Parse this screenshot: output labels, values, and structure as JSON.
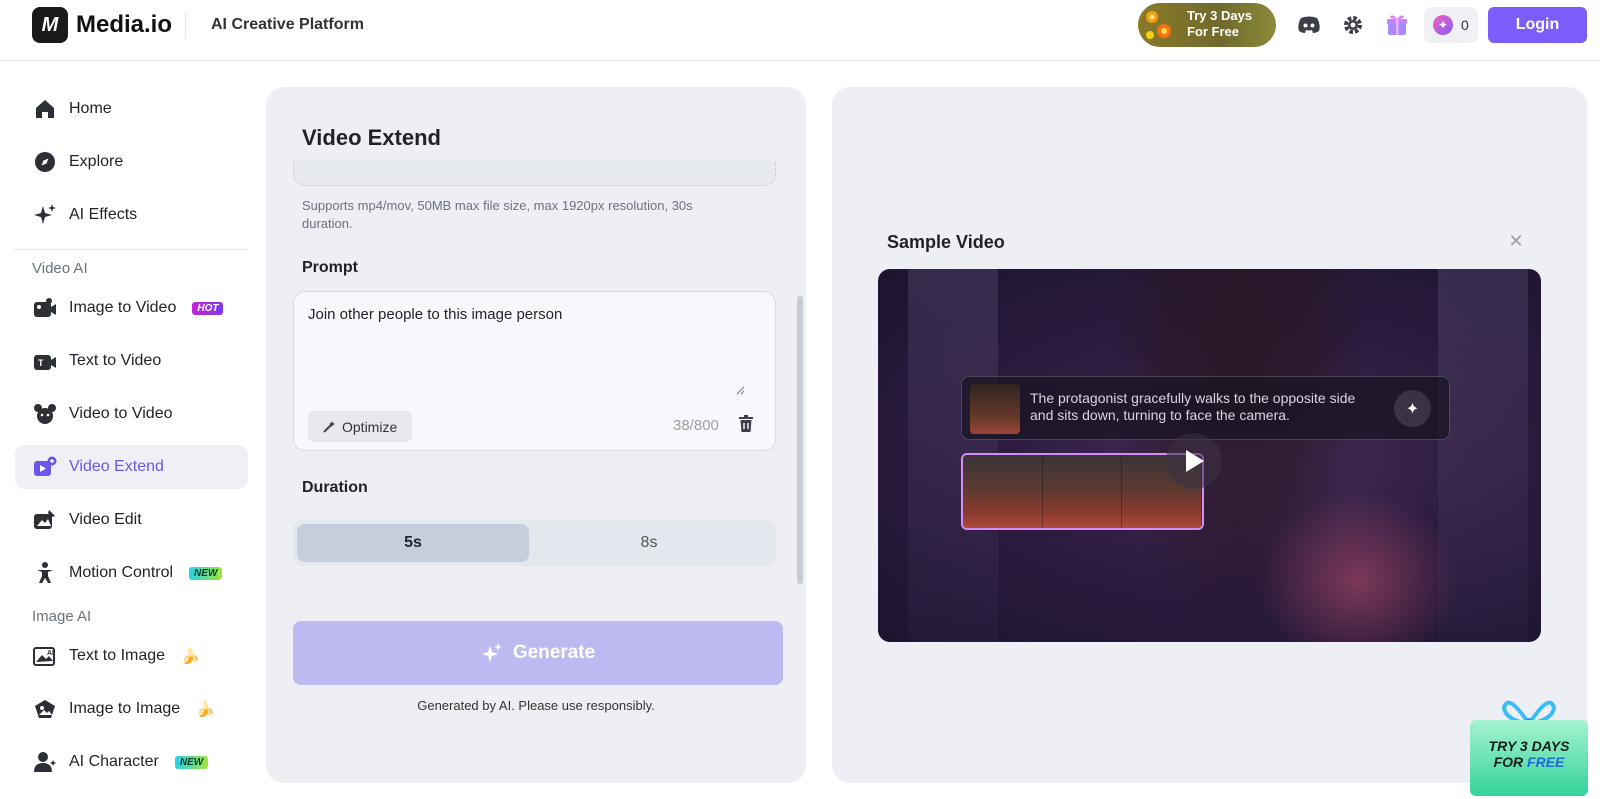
{
  "header": {
    "logo_mark": "M",
    "logo_text": "Media.io",
    "platform_label": "AI Creative Platform",
    "trial_badge": {
      "line1": "Try 3 Days",
      "line2": "For Free"
    },
    "credits": "0",
    "login_label": "Login"
  },
  "sidebar": {
    "items_top": [
      {
        "label": "Home",
        "icon": "home-icon"
      },
      {
        "label": "Explore",
        "icon": "compass-icon"
      },
      {
        "label": "AI Effects",
        "icon": "sparkles-icon"
      }
    ],
    "video_section": "Video AI",
    "video_items": [
      {
        "label": "Image to Video",
        "tag": "HOT",
        "icon": "image-to-video-icon"
      },
      {
        "label": "Text to Video",
        "icon": "text-to-video-icon"
      },
      {
        "label": "Video to Video",
        "icon": "video-to-video-icon"
      },
      {
        "label": "Video Extend",
        "icon": "video-extend-icon",
        "active": true
      },
      {
        "label": "Video Edit",
        "icon": "video-edit-icon"
      },
      {
        "label": "Motion Control",
        "tag": "NEW",
        "icon": "motion-control-icon"
      }
    ],
    "image_section": "Image AI",
    "image_items": [
      {
        "label": "Text to Image",
        "emoji": "🍌",
        "icon": "text-to-image-icon"
      },
      {
        "label": "Image to Image",
        "emoji": "🍌",
        "icon": "image-to-image-icon"
      },
      {
        "label": "AI Character",
        "tag": "NEW",
        "icon": "ai-character-icon"
      }
    ]
  },
  "tool": {
    "title": "Video Extend",
    "support_text": "Supports mp4/mov, 50MB max file size, max 1920px resolution, 30s duration.",
    "prompt_label": "Prompt",
    "prompt_value": "Join other people to this image person",
    "optimize_label": "Optimize",
    "char_count": "38/800",
    "duration_label": "Duration",
    "duration_options": [
      "5s",
      "8s"
    ],
    "duration_selected": "5s",
    "generate_label": "Generate",
    "disclaimer": "Generated by AI. Please use responsibly."
  },
  "sample": {
    "title": "Sample Video",
    "caption": "The protagonist gracefully walks to the opposite side and sits down, turning to face the camera."
  },
  "promo": {
    "line1": "TRY 3 DAYS",
    "line2a": "FOR ",
    "line2b": "FREE"
  },
  "colors": {
    "accent": "#7c5cfb",
    "active_text": "#6a56e8",
    "generate_disabled": "#bdb9f1"
  }
}
